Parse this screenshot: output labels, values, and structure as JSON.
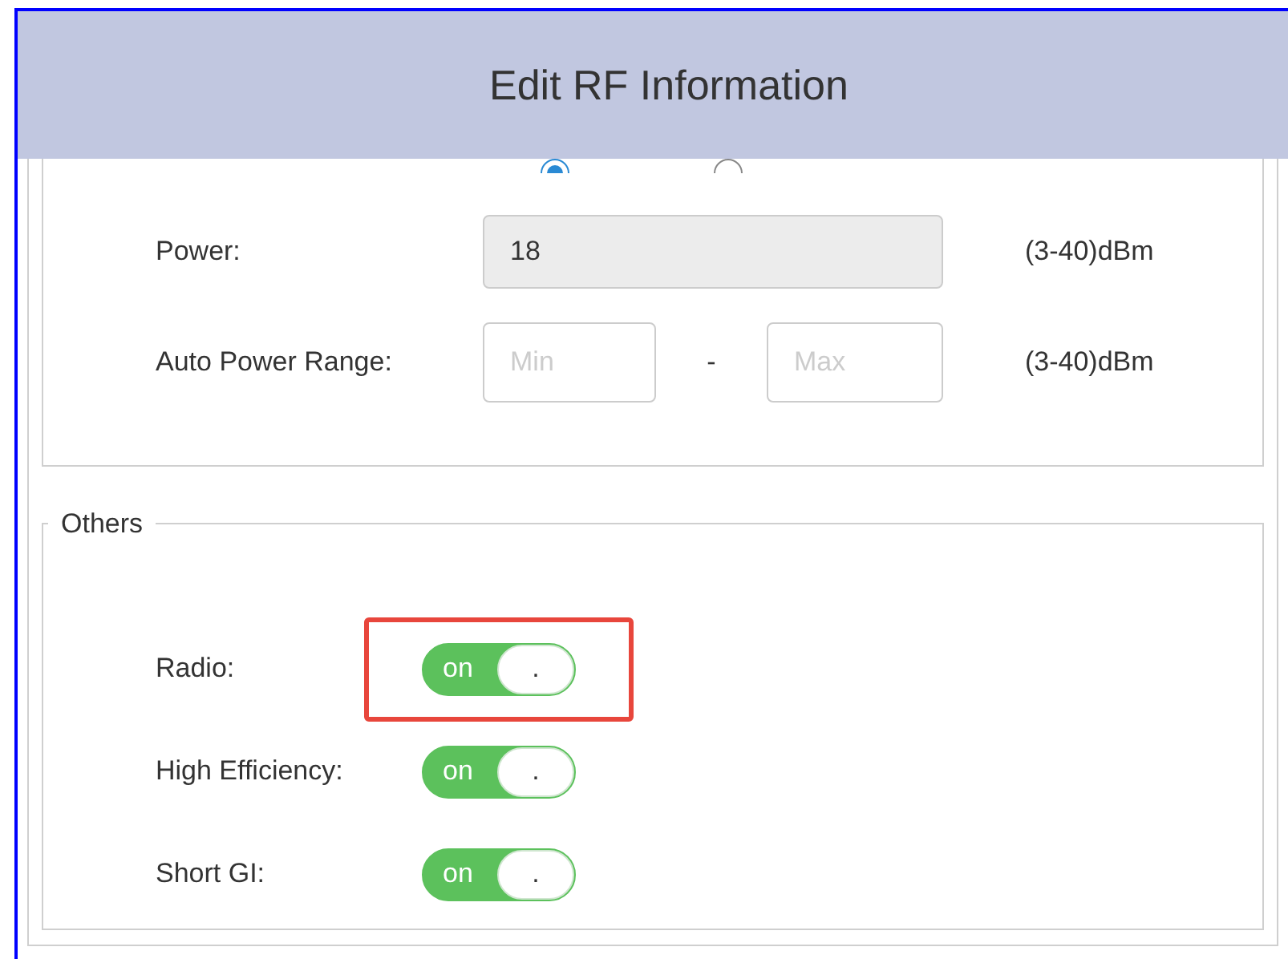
{
  "dialog": {
    "title": "Edit RF Information"
  },
  "power_section": {
    "radio_options": [
      {
        "selected": true
      },
      {
        "selected": false
      }
    ],
    "power": {
      "label": "Power:",
      "value": "18",
      "disabled": true,
      "unit": "(3-40)dBm"
    },
    "auto_power_range": {
      "label": "Auto Power Range:",
      "min_placeholder": "Min",
      "separator": "-",
      "max_placeholder": "Max",
      "unit": "(3-40)dBm"
    }
  },
  "others": {
    "legend": "Others",
    "toggles": [
      {
        "label": "Radio:",
        "on": true,
        "on_text": "on",
        "knob_text": ".",
        "highlighted": true
      },
      {
        "label": "High Efficiency:",
        "on": true,
        "on_text": "on",
        "knob_text": ".",
        "highlighted": false
      },
      {
        "label": "Short GI:",
        "on": true,
        "on_text": "on",
        "knob_text": ".",
        "highlighted": false
      }
    ]
  }
}
